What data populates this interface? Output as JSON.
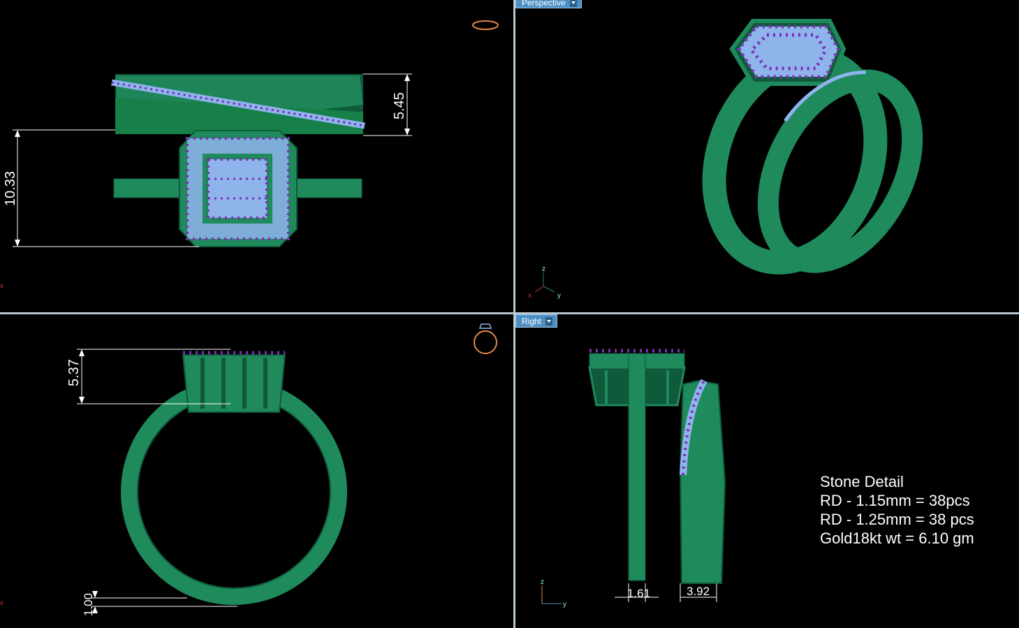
{
  "viewports": {
    "top_left": {
      "dimensions": {
        "height_top": "5.45",
        "height_total": "10.33"
      },
      "axis_label": "x"
    },
    "top_right": {
      "label": "Perspective",
      "axis": {
        "z": "z",
        "x": "x",
        "y": "y"
      }
    },
    "bottom_left": {
      "dimensions": {
        "top_height": "5.37",
        "bottom_thickness": "1.00"
      },
      "axis_label": "x"
    },
    "bottom_right": {
      "label": "Right",
      "dimensions": {
        "width_1": "1.61",
        "width_2": "3.92"
      },
      "axis": {
        "z": "z",
        "y": "y"
      },
      "stone_detail": {
        "title": "Stone Detail",
        "lines": [
          "RD - 1.15mm = 38pcs",
          "RD - 1.25mm = 38 pcs",
          "Gold18kt wt = 6.10 gm"
        ]
      }
    }
  },
  "colors": {
    "background": "#000000",
    "metal": "#1f8a5c",
    "metal_dark": "#0f5a3a",
    "stone_light": "#8fb4ec",
    "stone_purple": "#7a2fb5",
    "dimension_line": "#ffffff",
    "label_bg": "#4d8fc4",
    "divider": "#b9c7d2"
  }
}
